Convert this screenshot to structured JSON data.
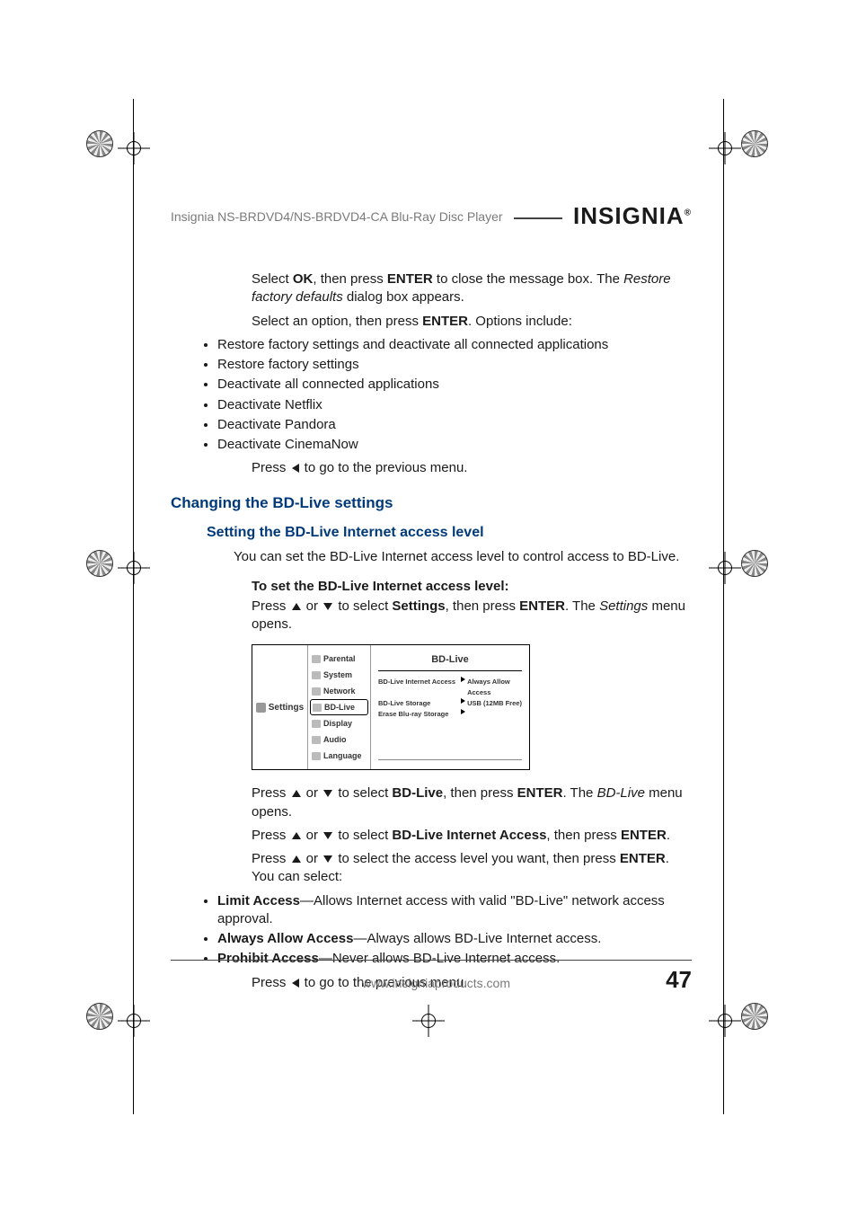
{
  "header": {
    "label": "Insignia NS-BRDVD4/NS-BRDVD4-CA Blu-Ray Disc Player",
    "brand": "INSIGNIA"
  },
  "restore": {
    "p1_a": "Select ",
    "p1_ok": "OK",
    "p1_b": ", then press ",
    "p1_enter": "ENTER",
    "p1_c": " to close the message box. The ",
    "p1_restore": "Restore factory defaults",
    "p1_d": " dialog box appears.",
    "p2_a": "Select an option, then press ",
    "p2_enter": "ENTER",
    "p2_b": ". Options include:",
    "options": [
      "Restore factory settings and deactivate all connected applications",
      "Restore factory settings",
      "Deactivate all connected applications",
      "Deactivate Netflix",
      "Deactivate Pandora",
      "Deactivate CinemaNow"
    ],
    "prev_a": "Press ",
    "prev_b": " to go to the previous menu."
  },
  "bdlive": {
    "h2": "Changing the BD-Live settings",
    "h3": "Setting the BD-Live Internet access level",
    "intro": "You can set the BD-Live Internet access level to control access to BD-Live.",
    "h4": "To set the BD-Live Internet access level:",
    "step1_a": "Press ",
    "step1_or": " or ",
    "step1_b": " to select ",
    "step1_settings": "Settings",
    "step1_c": ", then press ",
    "step1_enter": "ENTER",
    "step1_d": ". The ",
    "step1_settingsmenu": "Settings",
    "step1_e": " menu opens.",
    "ui": {
      "side_label": "Settings",
      "menu": [
        "Parental",
        "System",
        "Network",
        "BD-Live",
        "Display",
        "Audio",
        "Language"
      ],
      "selected_index": 3,
      "panel_title": "BD-Live",
      "rows": [
        {
          "k": "BD-Live Internet Access",
          "v": "Always Allow Access"
        },
        {
          "k": "BD-Live Storage",
          "v": "USB (12MB Free)"
        },
        {
          "k": "Erase Blu-ray Storage",
          "v": ""
        }
      ]
    },
    "step2_a": "Press ",
    "step2_or": " or ",
    "step2_b": " to select ",
    "step2_bdlive": "BD-Live",
    "step2_c": ", then press ",
    "step2_enter": "ENTER",
    "step2_d": ". The ",
    "step2_bdlivemenu": "BD-Live",
    "step2_e": " menu opens.",
    "step3_a": "Press ",
    "step3_or": " or ",
    "step3_b": " to select ",
    "step3_bia": "BD-Live Internet Access",
    "step3_c": ", then press ",
    "step3_enter": "ENTER",
    "step3_d": ".",
    "step4_a": "Press ",
    "step4_or": " or ",
    "step4_b": " to select the access level you want, then press ",
    "step4_enter": "ENTER",
    "step4_c": ". You can select:",
    "access_levels": [
      {
        "name": "Limit Access",
        "desc": "—Allows Internet access with valid \"BD-Live\" network access approval."
      },
      {
        "name": "Always Allow Access",
        "desc": "—Always allows BD-Live Internet access."
      },
      {
        "name": "Prohibit Access",
        "desc": "—Never allows BD-Live Internet access."
      }
    ],
    "prev_a": "Press ",
    "prev_b": " to go to the previous menu."
  },
  "footer": {
    "url": "www.insigniaproducts.com",
    "page": "47"
  }
}
